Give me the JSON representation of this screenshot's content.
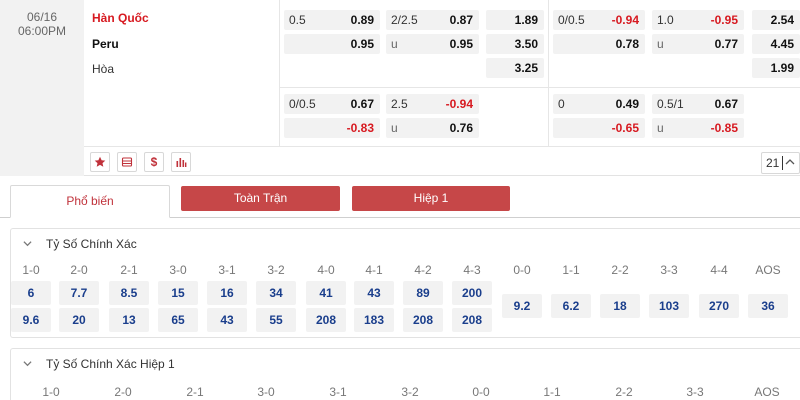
{
  "match": {
    "date": "06/16",
    "time": "06:00PM",
    "home": "Hàn Quốc",
    "away": "Peru",
    "draw": "Hòa",
    "markets_row1": {
      "ft_handicap": {
        "line": "0.5",
        "home": "0.89",
        "away": "0.95"
      },
      "ft_over_under": {
        "line": "2/2.5",
        "over": "0.87",
        "under_label": "u",
        "under": "0.95"
      },
      "ft_1x2": {
        "home": "1.89",
        "away": "3.50",
        "draw": "3.25"
      },
      "h1_handicap": {
        "line": "0/0.5",
        "home": "-0.94",
        "away": "0.78"
      },
      "h1_over_under": {
        "line": "1.0",
        "over": "-0.95",
        "under_label": "u",
        "under": "0.77"
      },
      "h1_1x2": {
        "home": "2.54",
        "away": "4.45",
        "draw": "1.99"
      }
    },
    "markets_row2": {
      "ft_handicap": {
        "line": "0/0.5",
        "home": "0.67",
        "away": "-0.83"
      },
      "ft_over_under": {
        "line": "2.5",
        "over": "-0.94",
        "under_label": "u",
        "under": "0.76"
      },
      "h1_handicap": {
        "line": "0",
        "home": "0.49",
        "away": "-0.65"
      },
      "h1_over_under": {
        "line": "0.5/1",
        "over": "0.67",
        "under_label": "u",
        "under": "-0.85"
      }
    },
    "icons": [
      "star-icon",
      "list-icon",
      "dollar-icon",
      "stats-icon"
    ],
    "more_count": "21"
  },
  "tabs": {
    "popular": "Phổ biến",
    "full_match": "Toàn Trận",
    "half1": "Hiệp 1"
  },
  "correct_score": {
    "title": "Tỷ Số Chính Xác",
    "labels": [
      "1-0",
      "2-0",
      "2-1",
      "3-0",
      "3-1",
      "3-2",
      "4-0",
      "4-1",
      "4-2",
      "4-3",
      "0-0",
      "1-1",
      "2-2",
      "3-3",
      "4-4",
      "AOS"
    ],
    "home_row": [
      "6",
      "7.7",
      "8.5",
      "15",
      "16",
      "34",
      "41",
      "43",
      "89",
      "200"
    ],
    "away_row": [
      "9.6",
      "20",
      "13",
      "65",
      "43",
      "55",
      "208",
      "183",
      "208",
      "208"
    ],
    "draws": [
      "9.2",
      "6.2",
      "18",
      "103",
      "270",
      "36"
    ]
  },
  "correct_score_h1": {
    "title": "Tỷ Số Chính Xác Hiệp 1",
    "labels": [
      "1-0",
      "2-0",
      "2-1",
      "3-0",
      "3-1",
      "3-2",
      "0-0",
      "1-1",
      "2-2",
      "3-3",
      "AOS"
    ]
  },
  "colors": {
    "accent": "#c64748",
    "negative": "#d71920",
    "score_value": "#1a3e8c"
  }
}
